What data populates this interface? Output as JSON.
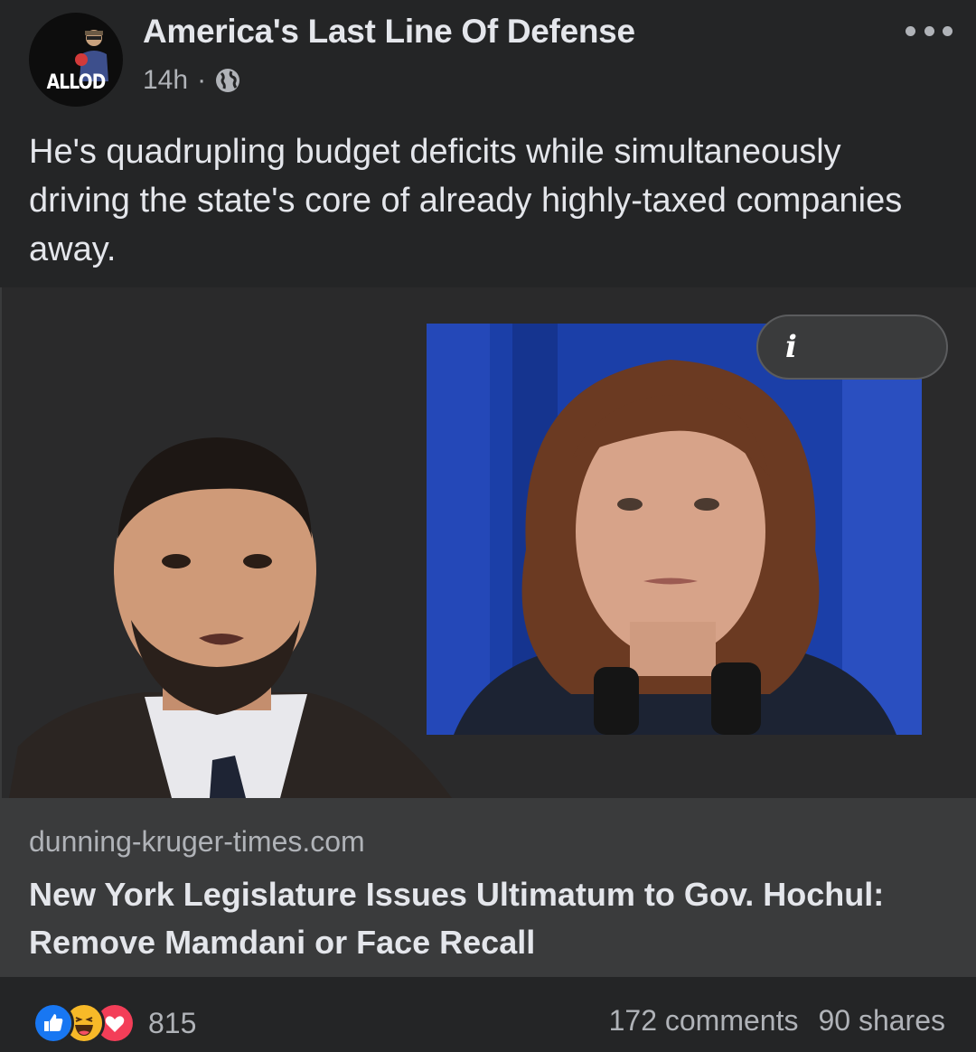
{
  "post": {
    "page_name": "America's Last Line Of Defense",
    "avatar_text": "ALLOD",
    "timestamp": "14h",
    "separator": "·",
    "audience_icon": "globe-icon",
    "menu_icon": "more-options-icon",
    "text": "He's quadrupling budget deficits while simultaneously driving the state's core of already highly-taxed companies away."
  },
  "link_preview": {
    "info_icon": "info-icon",
    "domain": "dunning-kruger-times.com",
    "title": "New York Legislature Issues Ultimatum to Gov. Hochul: Remove Mamdani or Face Recall"
  },
  "footer": {
    "reaction_icons": [
      "like-icon",
      "haha-icon",
      "love-icon"
    ],
    "reaction_count": "815",
    "comments": "172 comments",
    "shares": "90 shares"
  },
  "colors": {
    "background": "#242526",
    "card": "#3a3b3c",
    "text_primary": "#e4e6eb",
    "text_secondary": "#b0b3b8",
    "like_blue": "#1877f2",
    "love_red": "#f33e58",
    "haha_yellow": "#f7b928"
  }
}
